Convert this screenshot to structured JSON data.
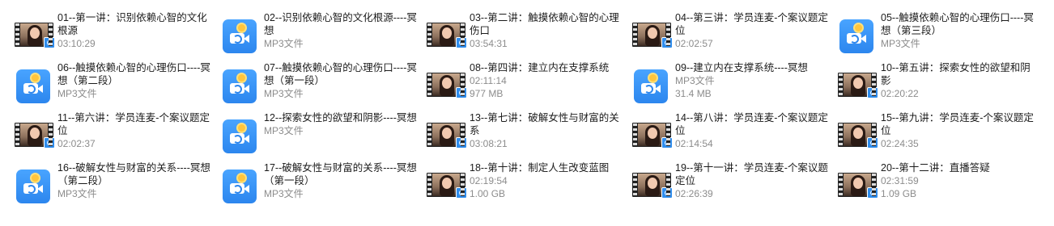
{
  "files": [
    {
      "name": "01--第一讲：识别依赖心智的文化根源",
      "type": "video",
      "line2": "03:10:29",
      "line3": ""
    },
    {
      "name": "02--识别依赖心智的文化根源----冥想",
      "type": "mp3",
      "line2": "MP3文件",
      "line3": ""
    },
    {
      "name": "03--第二讲：触摸依赖心智的心理伤口",
      "type": "video",
      "line2": "03:54:31",
      "line3": ""
    },
    {
      "name": "04--第三讲：学员连麦-个案议题定位",
      "type": "video",
      "line2": "02:02:57",
      "line3": ""
    },
    {
      "name": "05--触摸依赖心智的心理伤口----冥想（第三段）",
      "type": "mp3",
      "line2": "MP3文件",
      "line3": ""
    },
    {
      "name": "06--触摸依赖心智的心理伤口----冥想（第二段）",
      "type": "mp3",
      "line2": "MP3文件",
      "line3": ""
    },
    {
      "name": "07--触摸依赖心智的心理伤口----冥想（第一段）",
      "type": "mp3",
      "line2": "MP3文件",
      "line3": ""
    },
    {
      "name": "08--第四讲：建立内在支撑系统",
      "type": "video",
      "line2": "02:11:14",
      "line3": "977 MB"
    },
    {
      "name": "09--建立内在支撑系统----冥想",
      "type": "mp3",
      "line2": "MP3文件",
      "line3": "31.4 MB"
    },
    {
      "name": "10--第五讲：探索女性的欲望和阴影",
      "type": "video",
      "line2": "02:20:22",
      "line3": ""
    },
    {
      "name": "11--第六讲：学员连麦-个案议题定位",
      "type": "video",
      "line2": "02:02:37",
      "line3": ""
    },
    {
      "name": "12--探索女性的欲望和阴影----冥想",
      "type": "mp3",
      "line2": "MP3文件",
      "line3": ""
    },
    {
      "name": "13--第七讲：破解女性与财富的关系",
      "type": "video",
      "line2": "03:08:21",
      "line3": ""
    },
    {
      "name": "14--第八讲：学员连麦-个案议题定位",
      "type": "video",
      "line2": "02:14:54",
      "line3": ""
    },
    {
      "name": "15--第九讲：学员连麦-个案议题定位",
      "type": "video",
      "line2": "02:24:35",
      "line3": ""
    },
    {
      "name": "16--破解女性与财富的关系----冥想（第二段）",
      "type": "mp3",
      "line2": "MP3文件",
      "line3": ""
    },
    {
      "name": "17--破解女性与财富的关系----冥想（第一段）",
      "type": "mp3",
      "line2": "MP3文件",
      "line3": ""
    },
    {
      "name": "18--第十讲：制定人生改变蓝图",
      "type": "video",
      "line2": "02:19:54",
      "line3": "1.00 GB"
    },
    {
      "name": "19--第十一讲：学员连麦-个案议题定位",
      "type": "video",
      "line2": "02:26:39",
      "line3": ""
    },
    {
      "name": "20--第十二讲：直播答疑",
      "type": "video",
      "line2": "02:31:59",
      "line3": "1.09 GB"
    }
  ]
}
